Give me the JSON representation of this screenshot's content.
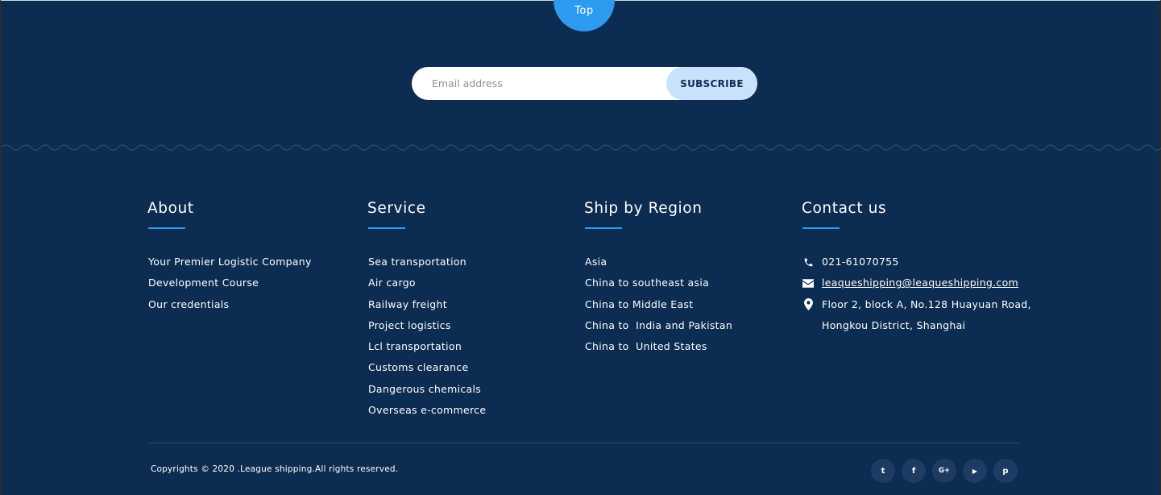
{
  "top_button": {
    "label": "Top"
  },
  "subscribe": {
    "placeholder": "Email address",
    "button_label": "SUBSCRIBE"
  },
  "about": {
    "title": "About",
    "links": [
      "Your Premier Logistic Company",
      "Development Course",
      "Our credentials"
    ]
  },
  "service": {
    "title": "Service",
    "links": [
      "Sea transportation",
      "Air cargo",
      "Railway freight",
      "Project logistics",
      "Lcl transportation",
      "Customs clearance",
      "Dangerous chemicals",
      "Overseas e-commerce"
    ]
  },
  "region": {
    "title": "Ship by Region",
    "links": [
      "Asia",
      "China to southeast asia",
      "China to Middle East",
      "China to  India and Pakistan",
      "China to  United States"
    ]
  },
  "contact": {
    "title": "Contact us",
    "phone": "021-61070755",
    "email": "leaqueshipping@leaqueshipping.com",
    "address_line1": "Floor 2, block A, No.128 Huayuan Road,",
    "address_line2": "Hongkou District, Shanghai",
    "icons": [
      "phone-icon",
      "envelope-icon",
      "map-pin-icon"
    ]
  },
  "footer": {
    "copyright": "Copyrights © 2020 .League shipping.All rights reserved.",
    "social": [
      {
        "icon": "twitter-icon",
        "glyph": "t"
      },
      {
        "icon": "facebook-icon",
        "glyph": "f"
      },
      {
        "icon": "google-plus-icon",
        "glyph": "G+"
      },
      {
        "icon": "youtube-icon",
        "glyph": "▶"
      },
      {
        "icon": "pinterest-icon",
        "glyph": "p"
      }
    ]
  },
  "colors": {
    "background": "#0d2c52",
    "accent": "#2e9bf0",
    "subscribe_button": "#c9e2fb",
    "social_bg": "#1d3b63"
  }
}
